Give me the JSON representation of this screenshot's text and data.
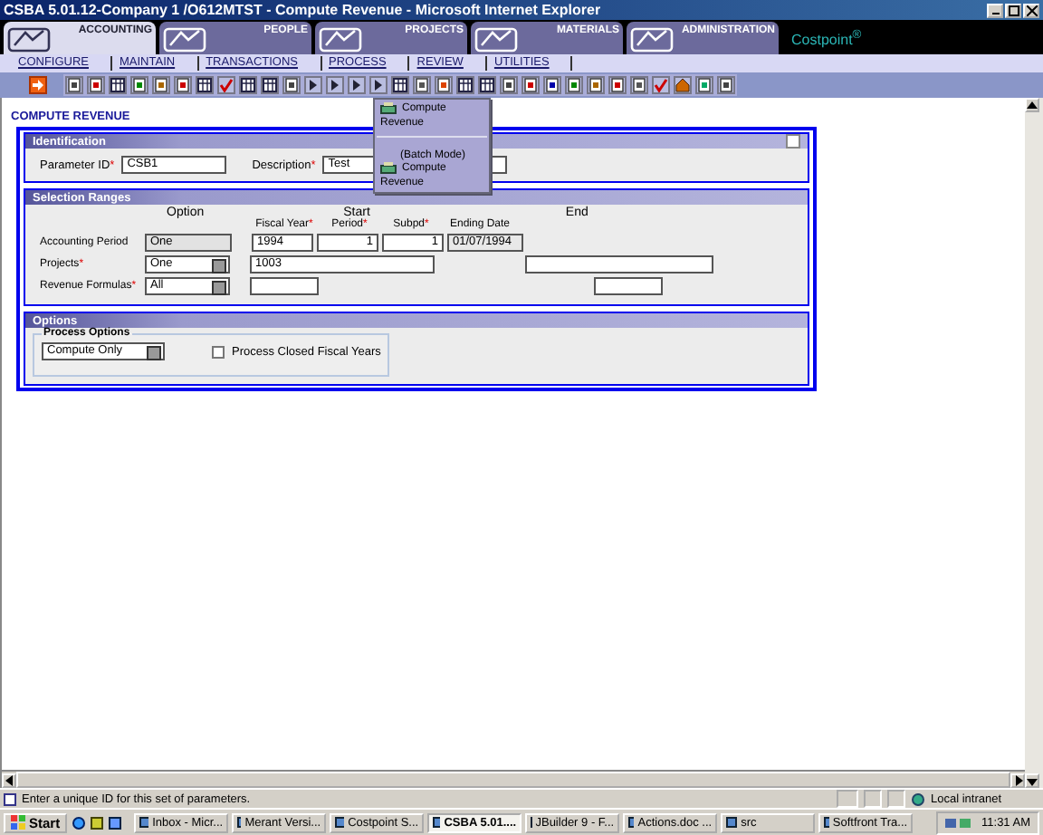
{
  "window": {
    "title": "CSBA 5.01.12-Company 1 /O612MTST - Compute Revenue - Microsoft Internet Explorer"
  },
  "module_tabs": [
    {
      "label": "ACCOUNTING",
      "selected": true
    },
    {
      "label": "PEOPLE",
      "selected": false
    },
    {
      "label": "PROJECTS",
      "selected": false
    },
    {
      "label": "MATERIALS",
      "selected": false
    },
    {
      "label": "ADMINISTRATION",
      "selected": false
    }
  ],
  "brand": "Costpoint$^{®}$",
  "required_mark": "*",
  "menu": [
    "CONFIGURE",
    "MAINTAIN",
    "TRANSACTIONS",
    "PROCESS",
    "REVIEW",
    "UTILITIES"
  ],
  "dropdown": [
    {
      "label": "Compute Revenue"
    },
    {
      "note": "(Batch Mode)",
      "label": "Compute Revenue"
    }
  ],
  "page_title": "COMPUTE REVENUE",
  "identification": {
    "title": "Identification",
    "fields": [
      {
        "label": "Parameter ID",
        "required": true,
        "value": "CSB1"
      },
      {
        "label": "Description",
        "required": true,
        "value": "Test"
      }
    ]
  },
  "selection_ranges": {
    "title": "Selection Ranges",
    "option_header": "Option",
    "start_header": "Start",
    "end_header": "End",
    "period_columns": [
      {
        "label": "Fiscal Year",
        "required": true
      },
      {
        "label": "Period",
        "required": true
      },
      {
        "label": "Subpd",
        "required": true
      },
      {
        "label": "Ending Date",
        "required": false
      }
    ],
    "rows": [
      {
        "kind": "period",
        "label": "Accounting Period",
        "required": false,
        "option": "One",
        "values": [
          "1994",
          "1",
          "1",
          "01/07/1994"
        ]
      },
      {
        "kind": "range",
        "label": "Projects",
        "required": true,
        "option": "One",
        "start": "1003"
      },
      {
        "kind": "range",
        "label": "Revenue Formulas",
        "required": true,
        "option": "All"
      }
    ]
  },
  "options": {
    "title": "Options",
    "group": "Process Options",
    "select": "Compute Only",
    "checkbox": {
      "label": "Process Closed Fiscal Years",
      "checked": false
    }
  },
  "status_bar": {
    "message": "Enter a unique ID for this set of parameters.",
    "zone": "Local intranet"
  },
  "taskbar": {
    "start": "Start",
    "tasks": [
      {
        "label": "Inbox - Micr...",
        "selected": false
      },
      {
        "label": "Merant Versi...",
        "selected": false
      },
      {
        "label": "Costpoint S...",
        "selected": false
      },
      {
        "label": "CSBA 5.01....",
        "selected": true
      },
      {
        "label": "JBuilder 9 - F...",
        "selected": false
      },
      {
        "label": "Actions.doc ...",
        "selected": false
      },
      {
        "label": "src",
        "selected": false
      },
      {
        "label": "Softfront Tra...",
        "selected": false
      }
    ],
    "clock": "11:31 AM"
  }
}
